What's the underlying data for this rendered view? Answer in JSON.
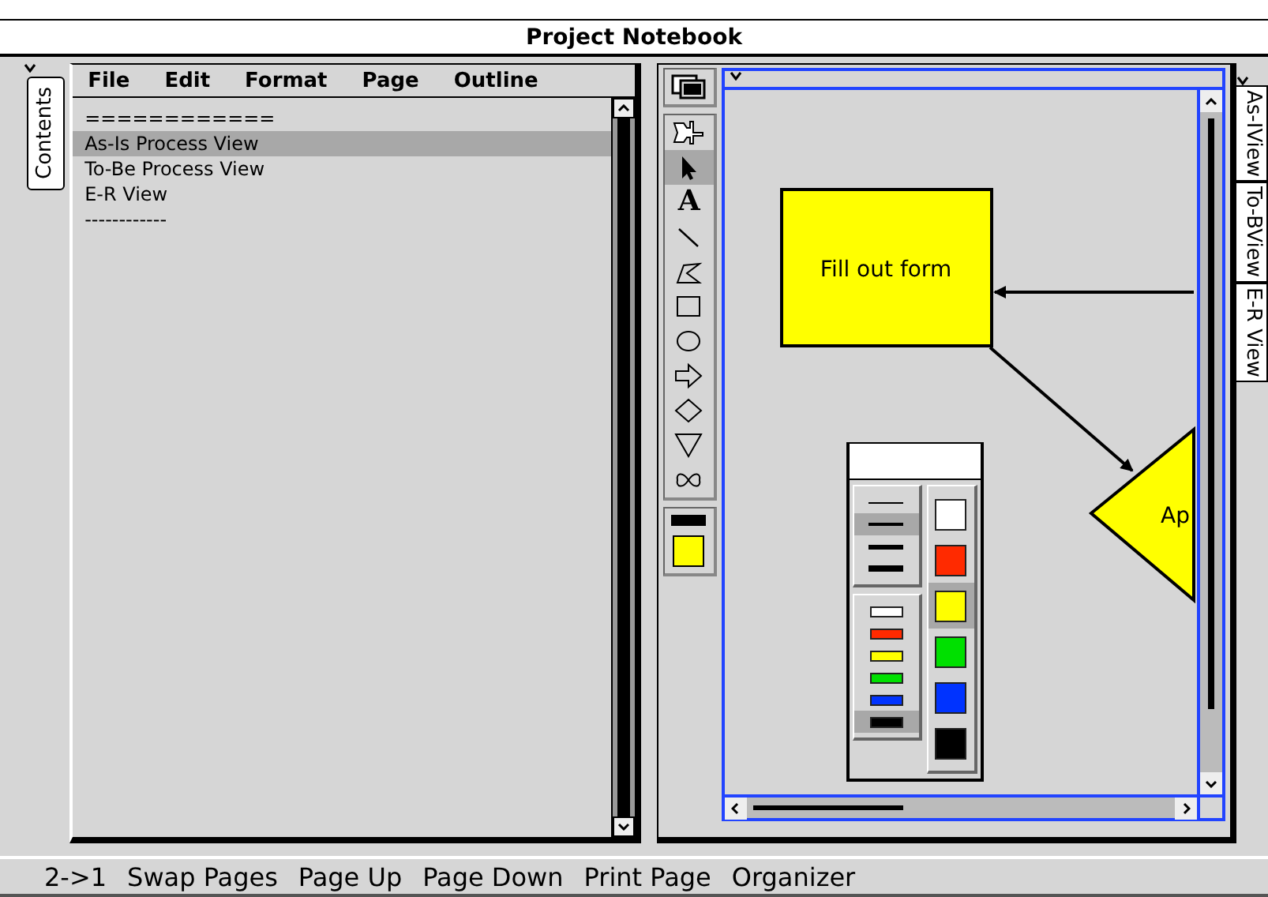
{
  "window": {
    "title": "Project Notebook"
  },
  "left_tab": {
    "label": "Contents"
  },
  "menu": [
    "File",
    "Edit",
    "Format",
    "Page",
    "Outline"
  ],
  "outline": [
    {
      "text": "============",
      "selected": false
    },
    {
      "text": "As-Is Process View",
      "selected": true
    },
    {
      "text": "To-Be Process View",
      "selected": false
    },
    {
      "text": "E-R View",
      "selected": false
    },
    {
      "text": "------------",
      "selected": false
    }
  ],
  "tools": [
    {
      "kind": "pin",
      "selected": false
    },
    {
      "kind": "pointer",
      "selected": true
    },
    {
      "kind": "text",
      "glyph": "A",
      "selected": false
    },
    {
      "kind": "line",
      "selected": false
    },
    {
      "kind": "polygon",
      "selected": false
    },
    {
      "kind": "rect",
      "selected": false
    },
    {
      "kind": "oval",
      "selected": false
    },
    {
      "kind": "arrow",
      "selected": false
    },
    {
      "kind": "diamond",
      "selected": false
    },
    {
      "kind": "triangle",
      "selected": false
    },
    {
      "kind": "freeform",
      "selected": false
    }
  ],
  "current_colors": [
    {
      "kind": "line",
      "color": "#000000"
    },
    {
      "kind": "fill",
      "color": "#ffff00"
    }
  ],
  "diagram": {
    "nodes": [
      {
        "kind": "rect",
        "label": "Fill out form"
      },
      {
        "kind": "diamond",
        "label": "Ap"
      }
    ]
  },
  "palette": {
    "line_widths": [
      {
        "selected": false
      },
      {
        "selected": true
      },
      {
        "selected": false
      },
      {
        "selected": false
      }
    ],
    "line_colors": [
      {
        "color": "#ffffff",
        "selected": false
      },
      {
        "color": "#ff2a00",
        "selected": false
      },
      {
        "color": "#ffff00",
        "selected": false
      },
      {
        "color": "#00e000",
        "selected": false
      },
      {
        "color": "#0033ff",
        "selected": false
      },
      {
        "color": "#000000",
        "selected": true
      }
    ],
    "fill_colors": [
      {
        "color": "#ffffff",
        "selected": false
      },
      {
        "color": "#ff2a00",
        "selected": false
      },
      {
        "color": "#ffff00",
        "selected": true
      },
      {
        "color": "#00e000",
        "selected": false
      },
      {
        "color": "#0033ff",
        "selected": false
      },
      {
        "color": "#000000",
        "selected": false
      }
    ]
  },
  "right_tabs": [
    {
      "label": "As-IView"
    },
    {
      "label": "To-BView"
    },
    {
      "label": "E-R View"
    }
  ],
  "status_bar": [
    "2->1",
    "Swap Pages",
    "Page Up",
    "Page Down",
    "Print Page",
    "Organizer"
  ]
}
